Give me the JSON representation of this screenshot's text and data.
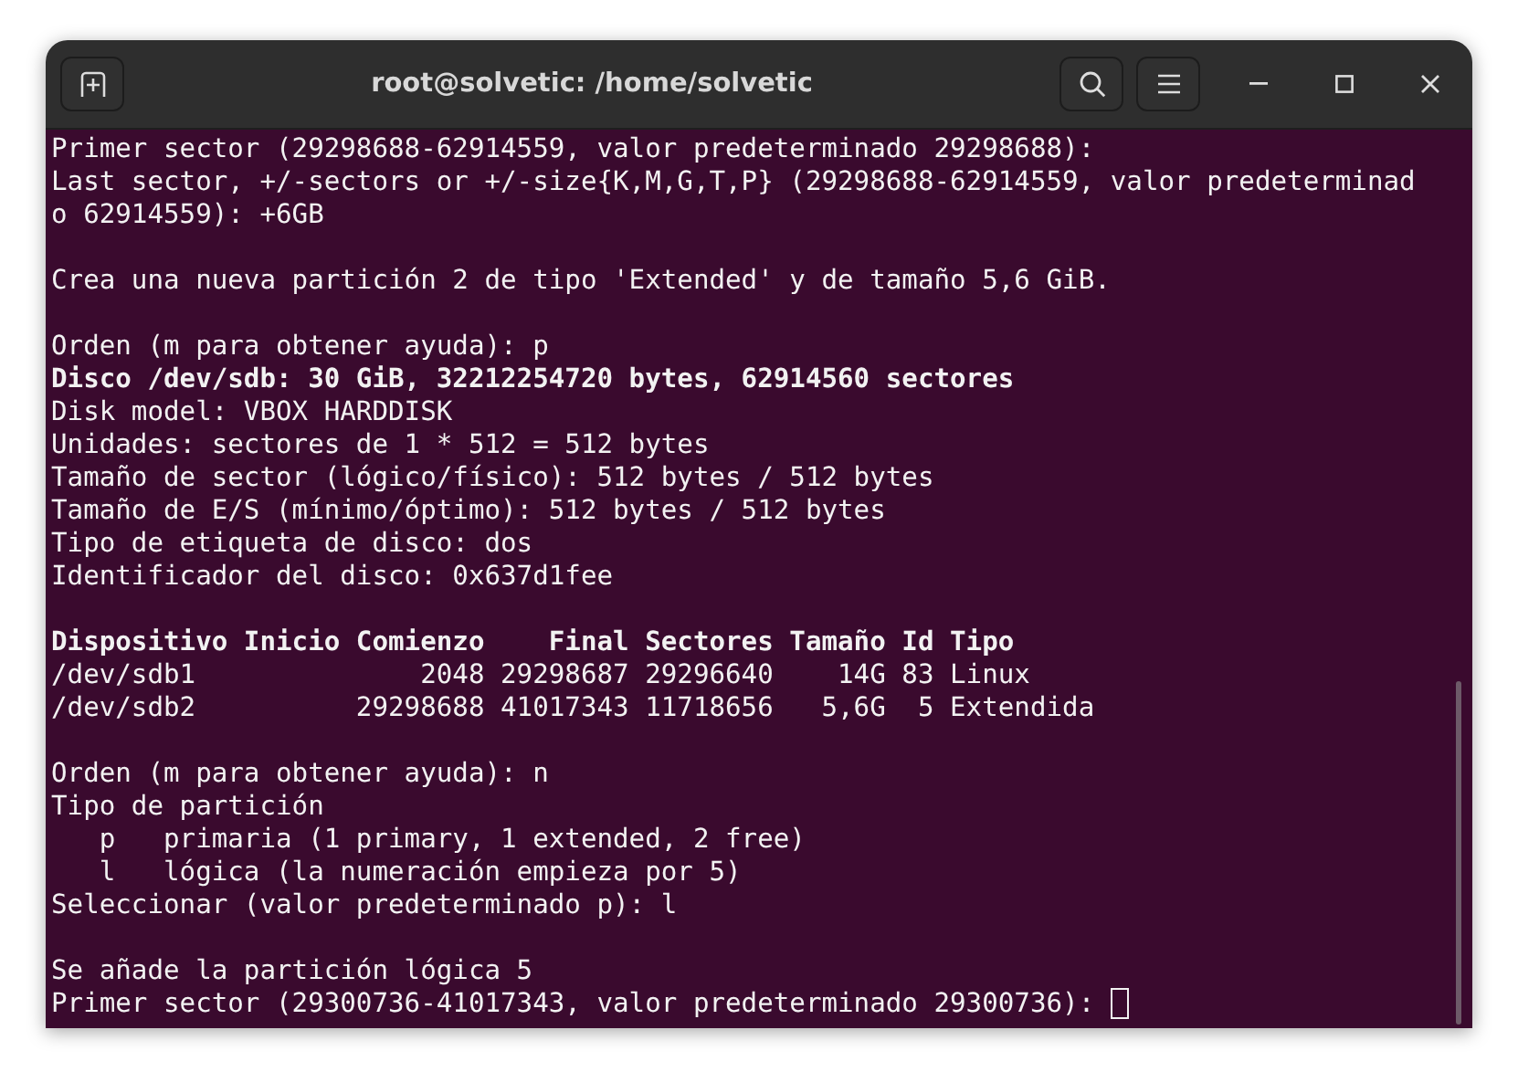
{
  "window": {
    "title": "root@solvetic: /home/solvetic"
  },
  "terminal": {
    "lines": [
      {
        "kind": "text",
        "text": "Primer sector (29298688-62914559, valor predeterminado 29298688):",
        "bold": false
      },
      {
        "kind": "text",
        "text": "Last sector, +/-sectors or +/-size{K,M,G,T,P} (29298688-62914559, valor predeterminad",
        "bold": false
      },
      {
        "kind": "text",
        "text": "o 62914559): +6GB",
        "bold": false
      },
      {
        "kind": "blank"
      },
      {
        "kind": "text",
        "text": "Crea una nueva partición 2 de tipo 'Extended' y de tamaño 5,6 GiB.",
        "bold": false
      },
      {
        "kind": "blank"
      },
      {
        "kind": "text",
        "text": "Orden (m para obtener ayuda): p",
        "bold": false
      },
      {
        "kind": "text",
        "text": "Disco /dev/sdb: 30 GiB, 32212254720 bytes, 62914560 sectores",
        "bold": true
      },
      {
        "kind": "text",
        "text": "Disk model: VBOX HARDDISK",
        "bold": false
      },
      {
        "kind": "text",
        "text": "Unidades: sectores de 1 * 512 = 512 bytes",
        "bold": false
      },
      {
        "kind": "text",
        "text": "Tamaño de sector (lógico/físico): 512 bytes / 512 bytes",
        "bold": false
      },
      {
        "kind": "text",
        "text": "Tamaño de E/S (mínimo/óptimo): 512 bytes / 512 bytes",
        "bold": false
      },
      {
        "kind": "text",
        "text": "Tipo de etiqueta de disco: dos",
        "bold": false
      },
      {
        "kind": "text",
        "text": "Identificador del disco: 0x637d1fee",
        "bold": false
      },
      {
        "kind": "blank"
      },
      {
        "kind": "text",
        "text": "Dispositivo Inicio Comienzo    Final Sectores Tamaño Id Tipo",
        "bold": true
      },
      {
        "kind": "text",
        "text": "/dev/sdb1              2048 29298687 29296640    14G 83 Linux",
        "bold": false
      },
      {
        "kind": "text",
        "text": "/dev/sdb2          29298688 41017343 11718656   5,6G  5 Extendida",
        "bold": false
      },
      {
        "kind": "blank"
      },
      {
        "kind": "text",
        "text": "Orden (m para obtener ayuda): n",
        "bold": false
      },
      {
        "kind": "text",
        "text": "Tipo de partición",
        "bold": false
      },
      {
        "kind": "text",
        "text": "   p   primaria (1 primary, 1 extended, 2 free)",
        "bold": false
      },
      {
        "kind": "text",
        "text": "   l   lógica (la numeración empieza por 5)",
        "bold": false
      },
      {
        "kind": "text",
        "text": "Seleccionar (valor predeterminado p): l",
        "bold": false
      },
      {
        "kind": "blank"
      },
      {
        "kind": "text",
        "text": "Se añade la partición lógica 5",
        "bold": false
      },
      {
        "kind": "prompt",
        "text": "Primer sector (29300736-41017343, valor predeterminado 29300736): ",
        "bold": false
      }
    ]
  }
}
